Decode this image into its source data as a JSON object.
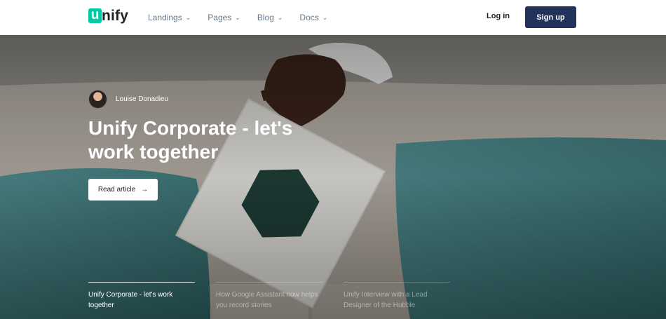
{
  "brand": {
    "mark": "u",
    "rest": "nify"
  },
  "nav": {
    "items": [
      {
        "label": "Landings",
        "icon": "chevron-down-icon"
      },
      {
        "label": "Pages",
        "icon": "chevron-down-icon"
      },
      {
        "label": "Blog",
        "icon": "chevron-down-icon"
      },
      {
        "label": "Docs",
        "icon": "chevron-down-icon"
      }
    ],
    "login": "Log in",
    "signup": "Sign up"
  },
  "hero": {
    "author": "Louise Donadieu",
    "title": "Unify Corporate - let's work together",
    "cta": "Read article",
    "cta_icon": "arrow-right-icon"
  },
  "slides": [
    {
      "title": "Unify Corporate - let's work together",
      "active": true
    },
    {
      "title": "How Google Assistant now helps you record stories",
      "active": false
    },
    {
      "title": "Unify Interview with a Lead Designer of the Hubble",
      "active": false
    }
  ],
  "colors": {
    "accent": "#00c9a7",
    "primary": "#21325b",
    "text": "#1e2022",
    "muted": "#677788"
  }
}
